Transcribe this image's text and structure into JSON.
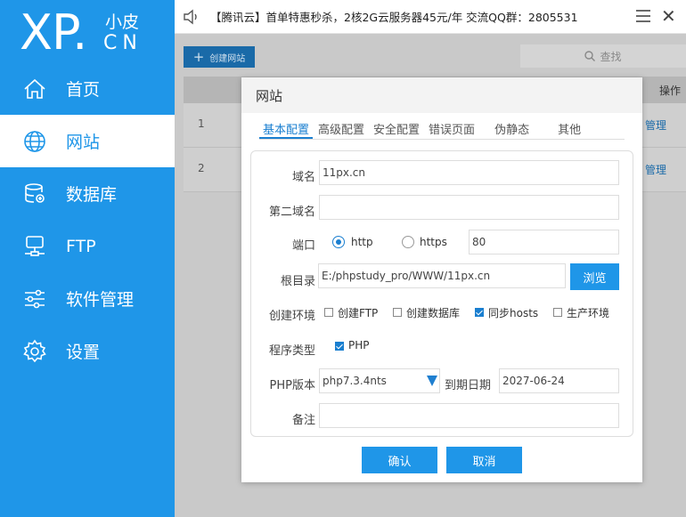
{
  "colors": {
    "primary": "#1f96e8",
    "active_tab": "#1a7fd0"
  },
  "logo": {
    "brand": "XP.",
    "small": "小皮",
    "suffix": "CN"
  },
  "nav": [
    {
      "label": "首页",
      "icon": "home-icon"
    },
    {
      "label": "网站",
      "icon": "globe-icon",
      "active": true
    },
    {
      "label": "数据库",
      "icon": "database-icon"
    },
    {
      "label": "FTP",
      "icon": "ftp-icon"
    },
    {
      "label": "软件管理",
      "icon": "sliders-icon"
    },
    {
      "label": "设置",
      "icon": "gear-icon"
    }
  ],
  "topbar": {
    "notice": "【腾讯云】首单特惠秒杀，2核2G云服务器45元/年 交流QQ群：2805531"
  },
  "main": {
    "create_label": "创建网站",
    "search_label": "查找",
    "op_header": "操作",
    "rows": [
      {
        "num": "1",
        "action": "管理"
      },
      {
        "num": "2",
        "action": "管理"
      }
    ]
  },
  "dialog": {
    "title": "网站",
    "tabs": [
      "基本配置",
      "高级配置",
      "安全配置",
      "错误页面",
      "伪静态",
      "其他"
    ],
    "labels": {
      "domain": "域名",
      "second_domain": "第二域名",
      "port": "端口",
      "root": "根目录",
      "env": "创建环境",
      "program": "程序类型",
      "php_version": "PHP版本",
      "expire": "到期日期",
      "note": "备注"
    },
    "values": {
      "domain": "11px.cn",
      "second_domain": "",
      "port": "80",
      "root": "E:/phpstudy_pro/WWW/11px.cn",
      "php_version": "php7.3.4nts",
      "expire": "2027-06-24",
      "note": ""
    },
    "port_options": {
      "http": "http",
      "https": "https"
    },
    "env_options": {
      "ftp": "创建FTP",
      "db": "创建数据库",
      "hosts": "同步hosts",
      "prod": "生产环境"
    },
    "program_option": "PHP",
    "browse_label": "浏览",
    "confirm_label": "确认",
    "cancel_label": "取消"
  }
}
